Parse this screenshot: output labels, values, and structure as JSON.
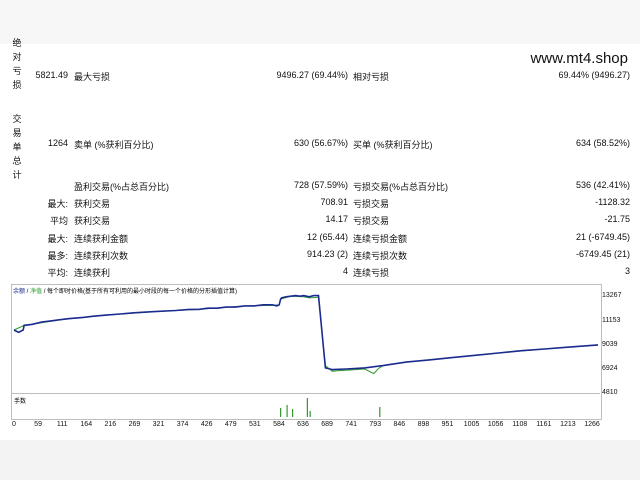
{
  "watermark": "www.mt4.shop",
  "side_labels": {
    "absolute_drawdown": [
      "绝",
      "对",
      "亏",
      "损"
    ],
    "trades_total": [
      "交",
      "易",
      "单",
      "总",
      "计"
    ]
  },
  "rows": [
    {
      "c1v": "5821.49",
      "c1l": "最大亏损",
      "c2v": "9496.27 (69.44%)",
      "c2l": "相对亏损",
      "c3v": "69.44% (9496.27)"
    },
    {
      "c1v": "1264",
      "c1l": "卖单 (%获利百分比)",
      "c2v": "630 (56.67%)",
      "c2l": "买单 (%获利百分比)",
      "c3v": "634 (58.52%)"
    },
    {
      "c1v": "",
      "c1l": "盈利交易(%占总百分比)",
      "c2v": "728 (57.59%)",
      "c2l": "亏损交易(%占总百分比)",
      "c3v": "536 (42.41%)"
    },
    {
      "c1v": "最大:",
      "c1l": "获利交易",
      "c2v": "708.91",
      "c2l": "亏损交易",
      "c3v": "-1128.32"
    },
    {
      "c1v": "平均",
      "c1l": "获利交易",
      "c2v": "14.17",
      "c2l": "亏损交易",
      "c3v": "-21.75"
    },
    {
      "c1v": "最大:",
      "c1l": "连续获利金额",
      "c2v": "12 (65.44)",
      "c2l": "连续亏损金额",
      "c3v": "21 (-6749.45)"
    },
    {
      "c1v": "最多:",
      "c1l": "连续获利次数",
      "c2v": "914.23 (2)",
      "c2l": "连续亏损次数",
      "c3v": "-6749.45 (21)"
    },
    {
      "c1v": "平均:",
      "c1l": "连续获利",
      "c2v": "4",
      "c2l": "连续亏损",
      "c3v": "3"
    }
  ],
  "chart": {
    "legend_balance": "余额",
    "legend_sep": " / ",
    "legend_equity": "净值",
    "legend_rest": " / 每个即时价格(基于所有可利用的最小时段的每一个价格的分形插值计算)",
    "subwindow_label": "手数",
    "colors": {
      "balance": "#1b2b8f",
      "equity": "#2c9a2c"
    }
  },
  "chart_data": {
    "type": "line",
    "yticks": [
      "13267",
      "11153",
      "9039",
      "6924",
      "4810"
    ],
    "xticks": [
      "0",
      "59",
      "111",
      "164",
      "216",
      "269",
      "321",
      "374",
      "426",
      "479",
      "531",
      "584",
      "636",
      "689",
      "741",
      "793",
      "846",
      "898",
      "951",
      "1005",
      "1056",
      "1108",
      "1161",
      "1213",
      "1266"
    ],
    "series": [
      {
        "name": "余额",
        "x": [
          0,
          10,
          20,
          22,
          40,
          60,
          80,
          100,
          120,
          150,
          170,
          200,
          230,
          260,
          300,
          350,
          380,
          400,
          420,
          440,
          460,
          480,
          500,
          520,
          540,
          560,
          570,
          575,
          578,
          580,
          590,
          600,
          610,
          620,
          628,
          640,
          650,
          660,
          675,
          690,
          720,
          760,
          800,
          850,
          900,
          950,
          1000,
          1050,
          1100,
          1150,
          1200,
          1266
        ],
        "y": [
          10300,
          10100,
          10300,
          10700,
          10800,
          11000,
          11100,
          11200,
          11300,
          11400,
          11500,
          11600,
          11700,
          11800,
          11900,
          12000,
          12100,
          12100,
          12200,
          12200,
          12300,
          12300,
          12400,
          12400,
          12500,
          12500,
          12400,
          12500,
          13000,
          13100,
          13200,
          13250,
          13300,
          13250,
          13300,
          13200,
          13300,
          13300,
          7000,
          6850,
          6900,
          7000,
          7200,
          7500,
          7700,
          7900,
          8100,
          8300,
          8500,
          8650,
          8800,
          9000
        ]
      },
      {
        "name": "净值",
        "x": [
          0,
          22,
          40,
          100,
          200,
          300,
          400,
          500,
          560,
          575,
          578,
          600,
          628,
          640,
          660,
          675,
          690,
          700,
          720,
          760,
          780,
          790,
          800,
          850,
          950,
          1050,
          1150,
          1266
        ],
        "y": [
          10300,
          10700,
          10800,
          11200,
          11600,
          11900,
          12100,
          12400,
          12450,
          12500,
          13000,
          13250,
          13200,
          13100,
          13150,
          7200,
          6700,
          6750,
          6800,
          6900,
          6500,
          6950,
          7200,
          7500,
          7900,
          8300,
          8650,
          9000
        ]
      }
    ],
    "volume": {
      "x": [
        578,
        592,
        604,
        636,
        642,
        793
      ],
      "y": [
        0.45,
        0.6,
        0.4,
        0.95,
        0.3,
        0.5
      ]
    }
  }
}
